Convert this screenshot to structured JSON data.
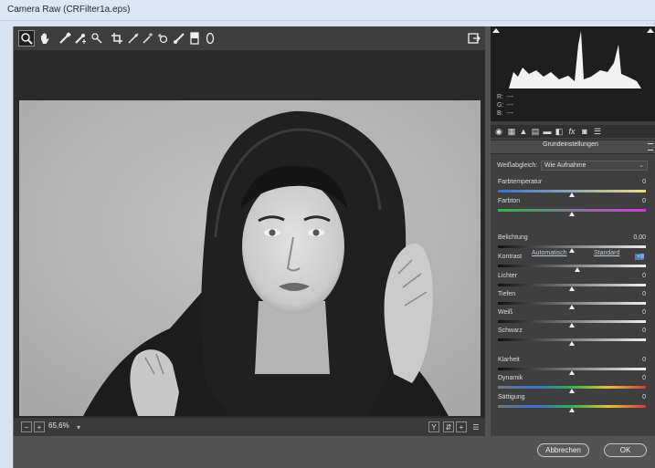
{
  "window": {
    "title": "Camera Raw (CRFilter1a.eps)"
  },
  "toolbar": {
    "tools": [
      "zoom-tool-icon",
      "hand-tool-icon",
      "white-balance-tool-icon",
      "color-sampler-tool-icon",
      "targeted-adjustment-tool-icon",
      "crop-tool-icon",
      "straighten-tool-icon",
      "spot-removal-tool-icon",
      "adjustment-brush-icon",
      "graduated-filter-icon",
      "radial-filter-icon"
    ]
  },
  "status": {
    "zoom": "65,6%"
  },
  "histogram": {
    "r": "R:",
    "g": "G:",
    "b": "B:",
    "dash": "---"
  },
  "panel": {
    "header": "Grundeinstellungen",
    "white_balance": {
      "label": "Weißabgleich:",
      "value": "Wie Aufnahme"
    },
    "auto_label": "Automatisch",
    "standard_label": "Standard",
    "sliders": [
      {
        "label": "Farbtemperatur",
        "value": "0",
        "pos": 0.5
      },
      {
        "label": "Farbton",
        "value": "0",
        "pos": 0.5
      },
      {
        "label": "Belichtung",
        "value": "0,00",
        "pos": 0.5
      },
      {
        "label": "Kontrast",
        "value": "+8",
        "pos": 0.54
      },
      {
        "label": "Lichter",
        "value": "0",
        "pos": 0.5
      },
      {
        "label": "Tiefen",
        "value": "0",
        "pos": 0.5
      },
      {
        "label": "Weiß",
        "value": "0",
        "pos": 0.5
      },
      {
        "label": "Schwarz",
        "value": "0",
        "pos": 0.5
      },
      {
        "label": "Klarheit",
        "value": "0",
        "pos": 0.5
      },
      {
        "label": "Dynamik",
        "value": "0",
        "pos": 0.5
      },
      {
        "label": "Sättigung",
        "value": "0",
        "pos": 0.5
      }
    ]
  },
  "buttons": {
    "cancel": "Abbrechen",
    "ok": "OK"
  },
  "colors": {
    "panel_bg": "#3f3f3f",
    "accent": "#4a7dc4",
    "link": "#b9cbe4"
  }
}
